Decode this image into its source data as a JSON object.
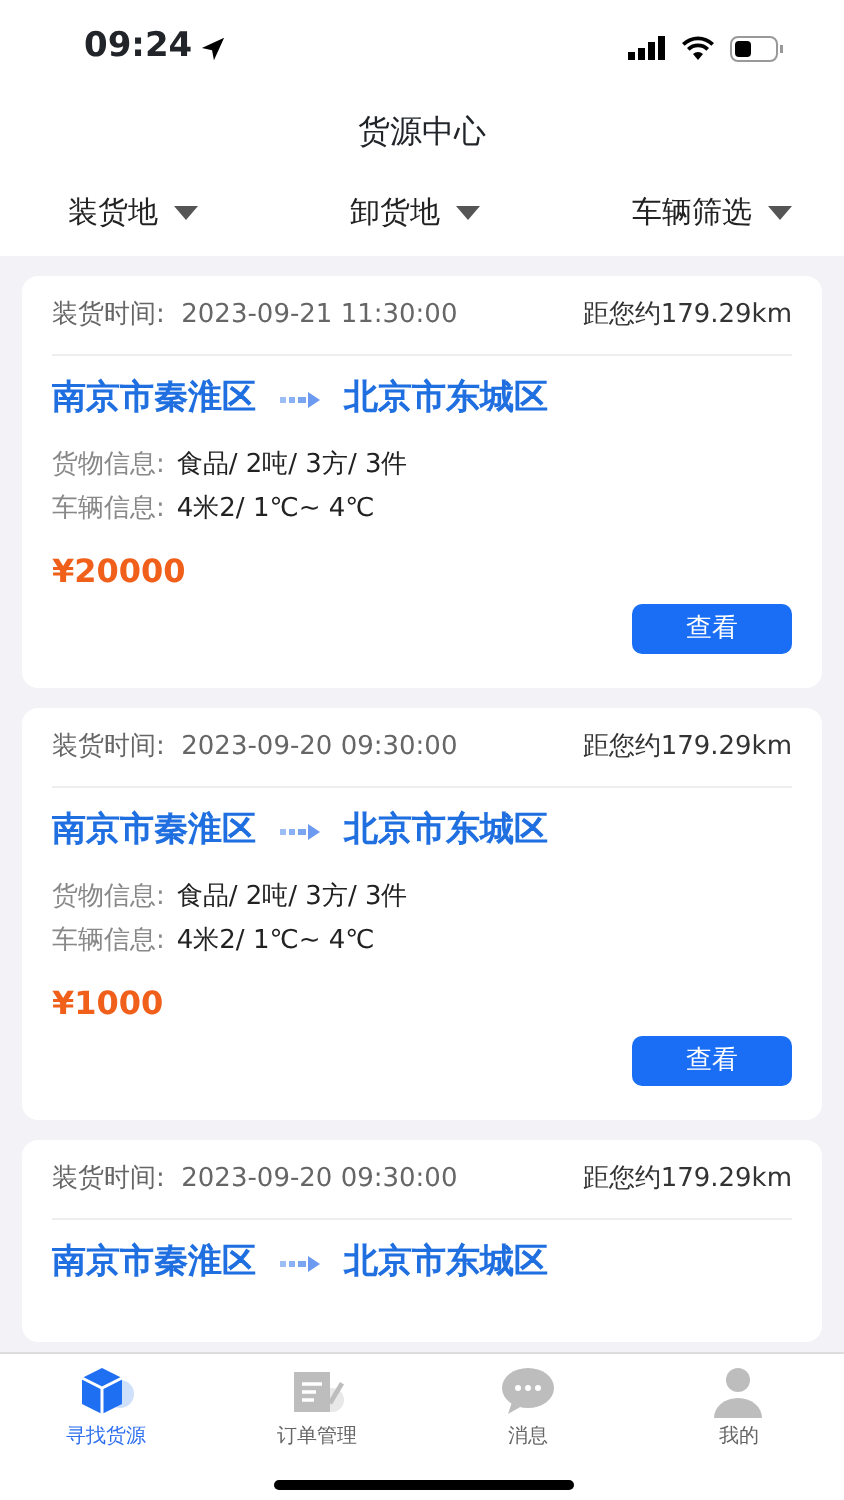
{
  "status_bar": {
    "time": "09:24"
  },
  "title": "货源中心",
  "filters": [
    {
      "label": "装货地"
    },
    {
      "label": "卸货地"
    },
    {
      "label": "车辆筛选"
    }
  ],
  "cards": [
    {
      "load_time_label": "装货时间:",
      "load_time": "2023-09-21 11:30:00",
      "distance": "距您约179.29km",
      "from": "南京市秦淮区",
      "to": "北京市东城区",
      "cargo_label": "货物信息:",
      "cargo": "食品/ 2吨/ 3方/ 3件",
      "vehicle_label": "车辆信息:",
      "vehicle": "4米2/ 1℃~ 4℃",
      "price": "¥20000",
      "button": "查看"
    },
    {
      "load_time_label": "装货时间:",
      "load_time": "2023-09-20 09:30:00",
      "distance": "距您约179.29km",
      "from": "南京市秦淮区",
      "to": "北京市东城区",
      "cargo_label": "货物信息:",
      "cargo": "食品/ 2吨/ 3方/ 3件",
      "vehicle_label": "车辆信息:",
      "vehicle": "4米2/ 1℃~ 4℃",
      "price": "¥1000",
      "button": "查看"
    },
    {
      "load_time_label": "装货时间:",
      "load_time": "2023-09-20 09:30:00",
      "distance": "距您约179.29km",
      "from": "南京市秦淮区",
      "to": "北京市东城区"
    }
  ],
  "tab_bar": [
    {
      "label": "寻找货源",
      "kind": "box",
      "selected": true
    },
    {
      "label": "订单管理",
      "kind": "edit",
      "selected": false
    },
    {
      "label": "消息",
      "kind": "chat",
      "selected": false
    },
    {
      "label": "我的",
      "kind": "person",
      "selected": false
    }
  ]
}
